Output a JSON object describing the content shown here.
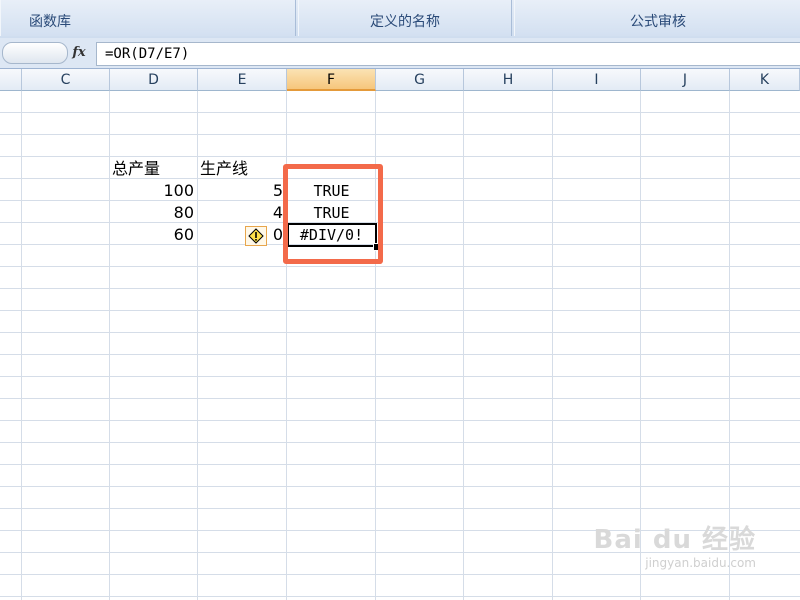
{
  "ribbon": {
    "groups": [
      {
        "label": "函数库"
      },
      {
        "label": "定义的名称"
      },
      {
        "label": "公式审核"
      }
    ]
  },
  "formula_bar": {
    "fx_label": "fx",
    "formula": "=OR(D7/E7)"
  },
  "columns": [
    "C",
    "D",
    "E",
    "F",
    "G",
    "H",
    "I",
    "J",
    "K"
  ],
  "selected_column": "F",
  "cells": {
    "D5": "总产量",
    "E5": "生产线",
    "D6": "100",
    "E6": "5",
    "F6": "TRUE",
    "D7": "80",
    "E7": "4",
    "F7": "TRUE",
    "D8": "60",
    "E8": "0",
    "F8": "#DIV/0!"
  },
  "watermark": {
    "brand": "Bai du 经验",
    "url": "jingyan.baidu.com"
  },
  "colors": {
    "highlight_box": "#f36a4a",
    "selected_header": "#f6c67c",
    "error_icon": "#e8a64c"
  }
}
